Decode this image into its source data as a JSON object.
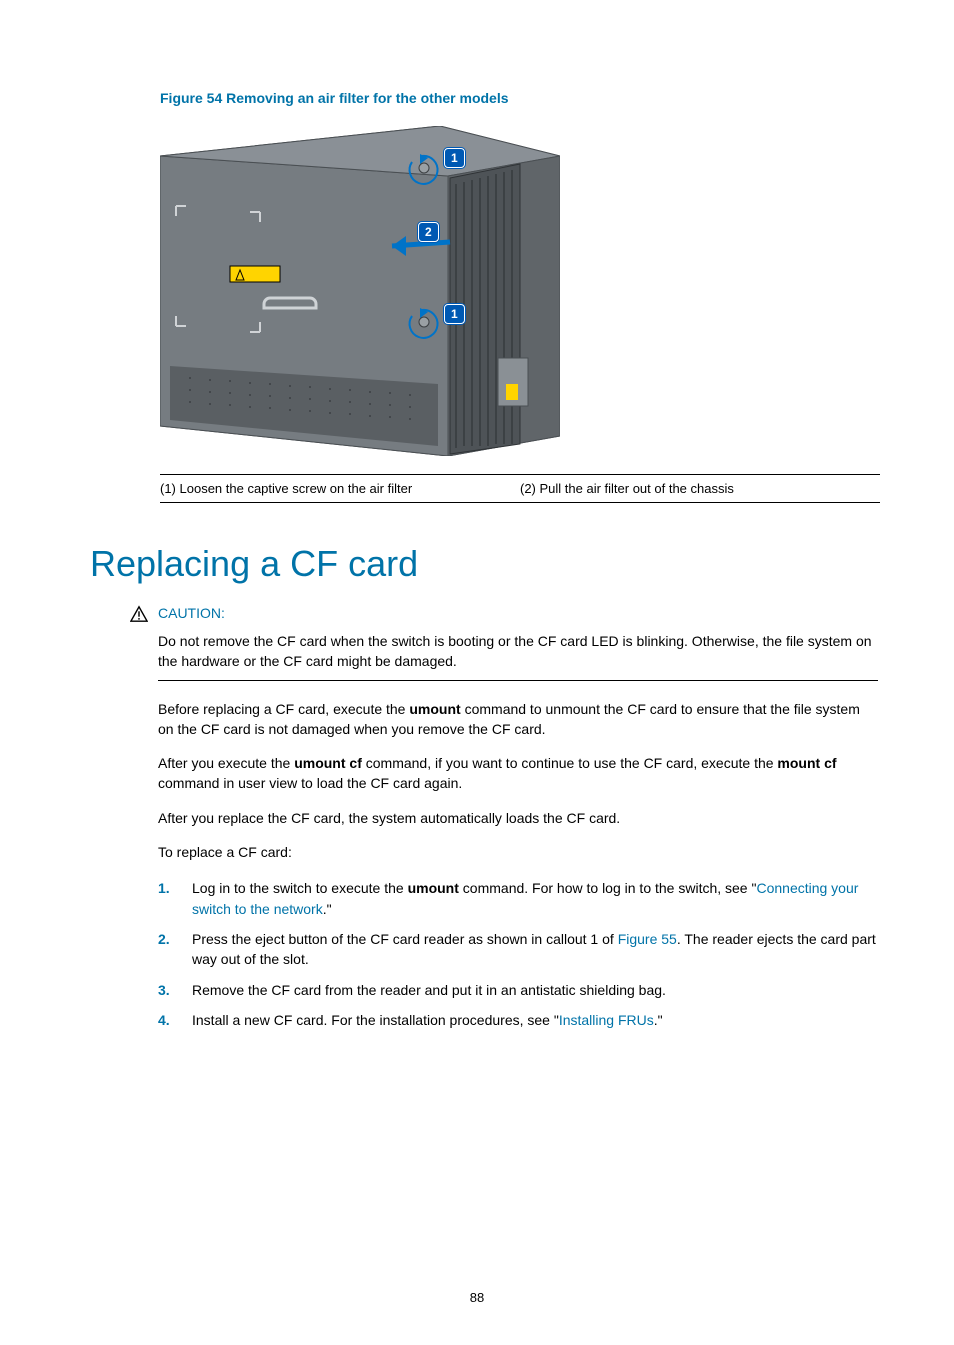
{
  "figure": {
    "caption": "Figure 54 Removing an air filter for the other models",
    "callouts": {
      "one": "1",
      "two": "2"
    },
    "legend": {
      "left": "(1) Loosen the captive screw on the air filter",
      "right": "(2) Pull the air filter out of the chassis"
    }
  },
  "heading": "Replacing a CF card",
  "caution": {
    "label": "CAUTION:",
    "text": "Do not remove the CF card when the switch is booting or the CF card LED is blinking. Otherwise, the file system on the hardware or the CF card might be damaged."
  },
  "paragraphs": {
    "p1_a": "Before replacing a CF card, execute the ",
    "p1_b": "umount",
    "p1_c": " command to unmount the CF card to ensure that the file system on the CF card is not damaged when you remove the CF card.",
    "p2_a": "After you execute the ",
    "p2_b": "umount cf",
    "p2_c": " command, if you want to continue to use the CF card, execute the ",
    "p2_d": "mount cf",
    "p2_e": " command in user view to load the CF card again.",
    "p3": "After you replace the CF card, the system automatically loads the CF card.",
    "p4": "To replace a CF card:"
  },
  "steps": {
    "s1_a": "Log in to the switch to execute the ",
    "s1_b": "umount",
    "s1_c": " command. For how to log in to the switch, see \"",
    "s1_link": "Connecting your switch to the network",
    "s1_d": ".\"",
    "s2_a": "Press the eject button of the CF card reader as shown in callout 1 of ",
    "s2_link": "Figure 55",
    "s2_b": ". The reader ejects the card part way out of the slot.",
    "s3": "Remove the CF card from the reader and put it in an antistatic shielding bag.",
    "s4_a": "Install a new CF card. For the installation procedures, see \"",
    "s4_link": "Installing FRUs",
    "s4_b": ".\""
  },
  "pageNumber": "88"
}
